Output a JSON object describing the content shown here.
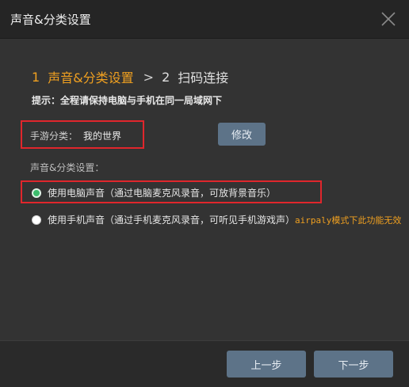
{
  "window": {
    "title": "声音&分类设置",
    "close_icon": "close-icon"
  },
  "steps": {
    "step1_number": "1",
    "step1_label": "声音&分类设置",
    "separator": ">",
    "step2_number": "2",
    "step2_label": "扫码连接"
  },
  "tip": "提示：全程请保持电脑与手机在同一局域网下",
  "game_category": {
    "label": "手游分类：",
    "value": "我的世界",
    "modify_label": "修改"
  },
  "sound": {
    "section_label": "声音&分类设置：",
    "options": [
      {
        "label": "使用电脑声音（通过电脑麦克风录音，可放背景音乐）",
        "checked": true
      },
      {
        "label": "使用手机声音（通过手机麦克风录音，可听见手机游戏声）",
        "checked": false,
        "note": "airpaly模式下此功能无效"
      }
    ]
  },
  "footer": {
    "prev_label": "上一步",
    "next_label": "下一步"
  },
  "colors": {
    "accent": "#f0a020",
    "button": "#5d7388",
    "highlight_border": "#e0262c",
    "radio_checked": "#3cbc6c"
  }
}
